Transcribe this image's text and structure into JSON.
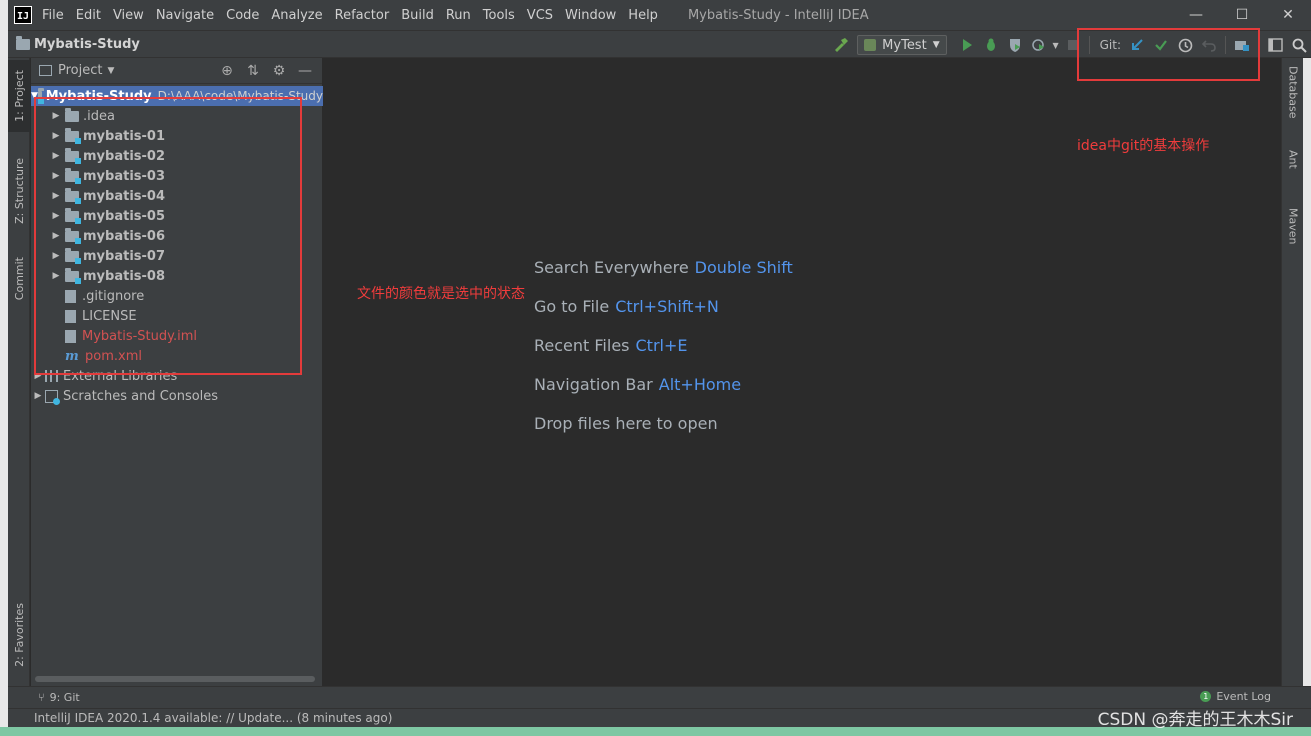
{
  "window": {
    "title": "Mybatis-Study - IntelliJ IDEA",
    "logo": "IJ",
    "controls": [
      "—",
      "☐",
      "✕"
    ]
  },
  "menu": [
    "File",
    "Edit",
    "View",
    "Navigate",
    "Code",
    "Analyze",
    "Refactor",
    "Build",
    "Run",
    "Tools",
    "VCS",
    "Window",
    "Help"
  ],
  "navbar": {
    "breadcrumb": "Mybatis-Study",
    "run_config": "MyTest",
    "git_label": "Git:"
  },
  "left_stripe": {
    "project": "1: Project",
    "structure": "Z: Structure",
    "commit": "Commit",
    "favorites": "2: Favorites"
  },
  "right_stripe": {
    "database": "Database",
    "ant": "Ant",
    "maven": "Maven"
  },
  "project_panel": {
    "title": "Project",
    "root": {
      "name": "Mybatis-Study",
      "path": "D:\\AAA\\code\\Mybatis-Study"
    },
    "items": [
      {
        "name": ".idea",
        "type": "folder",
        "bold": false
      },
      {
        "name": "mybatis-01",
        "type": "module",
        "bold": true
      },
      {
        "name": "mybatis-02",
        "type": "module",
        "bold": true
      },
      {
        "name": "mybatis-03",
        "type": "module",
        "bold": true
      },
      {
        "name": "mybatis-04",
        "type": "module",
        "bold": true
      },
      {
        "name": "mybatis-05",
        "type": "module",
        "bold": true
      },
      {
        "name": "mybatis-06",
        "type": "module",
        "bold": true
      },
      {
        "name": "mybatis-07",
        "type": "module",
        "bold": true
      },
      {
        "name": "mybatis-08",
        "type": "module",
        "bold": true
      },
      {
        "name": ".gitignore",
        "type": "file",
        "color": "normal"
      },
      {
        "name": "LICENSE",
        "type": "file",
        "color": "normal"
      },
      {
        "name": "Mybatis-Study.iml",
        "type": "file",
        "color": "red"
      },
      {
        "name": "pom.xml",
        "type": "maven",
        "color": "red"
      }
    ],
    "external_libraries": "External Libraries",
    "scratches": "Scratches and Consoles"
  },
  "editor_hints": [
    {
      "label": "Search Everywhere",
      "key": "Double Shift"
    },
    {
      "label": "Go to File",
      "key": "Ctrl+Shift+N"
    },
    {
      "label": "Recent Files",
      "key": "Ctrl+E"
    },
    {
      "label": "Navigation Bar",
      "key": "Alt+Home"
    },
    {
      "label": "Drop files here to open",
      "key": ""
    }
  ],
  "bottom_toolbar": {
    "git_tab": "9: Git",
    "event_log": "Event Log"
  },
  "statusbar": {
    "message": "IntelliJ IDEA 2020.1.4 available: // Update... (8 minutes ago)"
  },
  "annotations": {
    "git_note": "idea中git的基本操作",
    "file_color_note": "文件的颜色就是选中的状态"
  },
  "watermark": "CSDN @奔走的王木木Sir",
  "colors": {
    "selection": "#4b6eaf",
    "key_blue": "#5394ec",
    "vcs_red": "#d25252",
    "annotation_red": "#e33b3b"
  }
}
